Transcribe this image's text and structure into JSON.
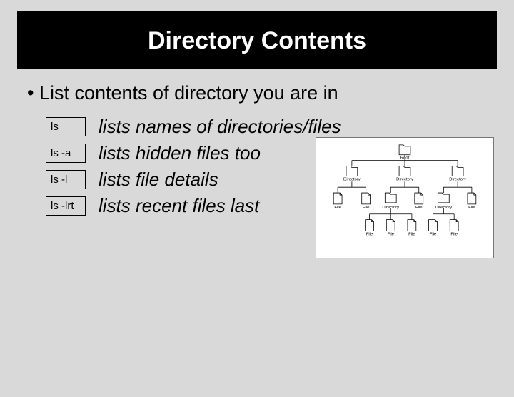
{
  "title": "Directory Contents",
  "bullet": "List contents of directory you are in",
  "rows": [
    {
      "cmd": "ls",
      "desc": "lists names of directories/files"
    },
    {
      "cmd": "ls  -a",
      "desc": "lists hidden files too"
    },
    {
      "cmd": "ls  -l",
      "desc": "lists file details"
    },
    {
      "cmd": "ls  -lrt",
      "desc": "lists recent files last"
    }
  ],
  "tree": {
    "root": "Root",
    "level1": [
      "Directory",
      "Directory",
      "Directory"
    ],
    "level2": [
      "File",
      "File",
      "Directory",
      "File",
      "Directory",
      "File"
    ],
    "level3": [
      "File",
      "File",
      "File",
      "File",
      "File"
    ]
  }
}
